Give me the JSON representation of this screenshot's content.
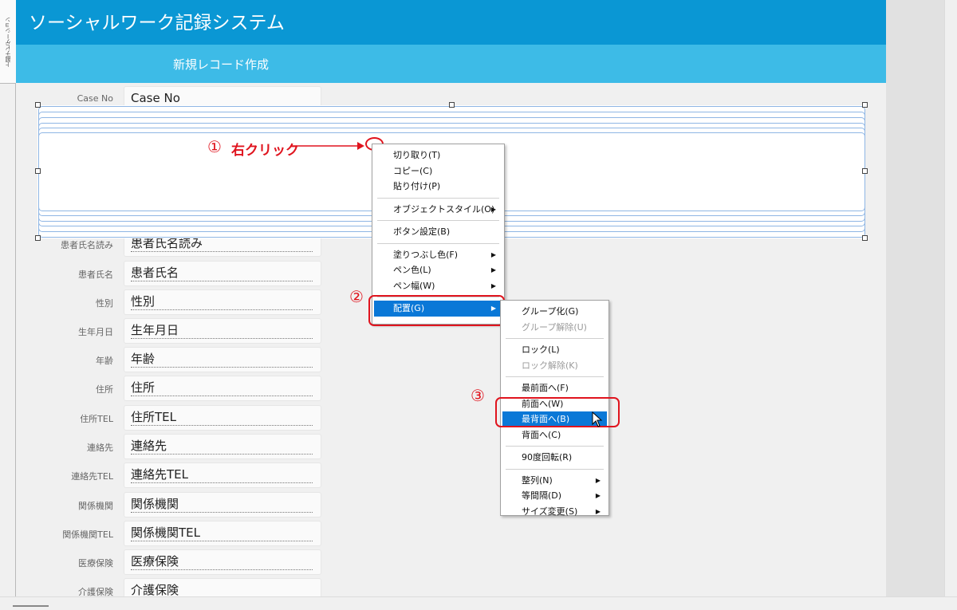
{
  "nav": {
    "tab_label": "上部ナビゲーション"
  },
  "header": {
    "title": "ソーシャルワーク記録システム",
    "subtitle": "新規レコード作成"
  },
  "fields": [
    {
      "label": "Case No",
      "value": "Case No"
    },
    {
      "label": "患者氏名読み",
      "value": "患者氏名読み"
    },
    {
      "label": "患者氏名",
      "value": "患者氏名"
    },
    {
      "label": "性別",
      "value": "性別"
    },
    {
      "label": "生年月日",
      "value": "生年月日"
    },
    {
      "label": "年齢",
      "value": "年齢"
    },
    {
      "label": "住所",
      "value": "住所"
    },
    {
      "label": "住所TEL",
      "value": "住所TEL"
    },
    {
      "label": "連絡先",
      "value": "連絡先"
    },
    {
      "label": "連絡先TEL",
      "value": "連絡先TEL"
    },
    {
      "label": "関係機関",
      "value": "関係機関"
    },
    {
      "label": "関係機関TEL",
      "value": "関係機関TEL"
    },
    {
      "label": "医療保険",
      "value": "医療保険"
    },
    {
      "label": "介護保険",
      "value": "介護保険"
    }
  ],
  "annotations": {
    "step1_num": "①",
    "step1_text": "右クリック",
    "step2_num": "②",
    "step3_num": "③"
  },
  "context_menu": {
    "cut": "切り取り(T)",
    "copy": "コピー(C)",
    "paste": "貼り付け(P)",
    "object_style": "オブジェクトスタイル(O)",
    "button_settings": "ボタン設定(B)",
    "fill_color": "塗りつぶし色(F)",
    "pen_color": "ペン色(L)",
    "pen_width": "ペン幅(W)",
    "arrange": "配置(G)"
  },
  "arrange_submenu": {
    "group": "グループ化(G)",
    "ungroup": "グループ解除(U)",
    "lock": "ロック(L)",
    "unlock": "ロック解除(K)",
    "bring_to_front": "最前面へ(F)",
    "bring_forward": "前面へ(W)",
    "send_to_back": "最背面へ(B)",
    "send_backward": "背面へ(C)",
    "rotate90": "90度回転(R)",
    "align": "整列(N)",
    "distribute": "等間隔(D)",
    "resize": "サイズ変更(S)"
  },
  "colors": {
    "title_bar": "#0a97d4",
    "sub_bar": "#3dbbe7",
    "annotation_red": "#e0141e",
    "menu_highlight": "#0a78d7"
  },
  "icons": {
    "submenu_arrow": "triangle-right",
    "cursor": "mouse-pointer"
  }
}
